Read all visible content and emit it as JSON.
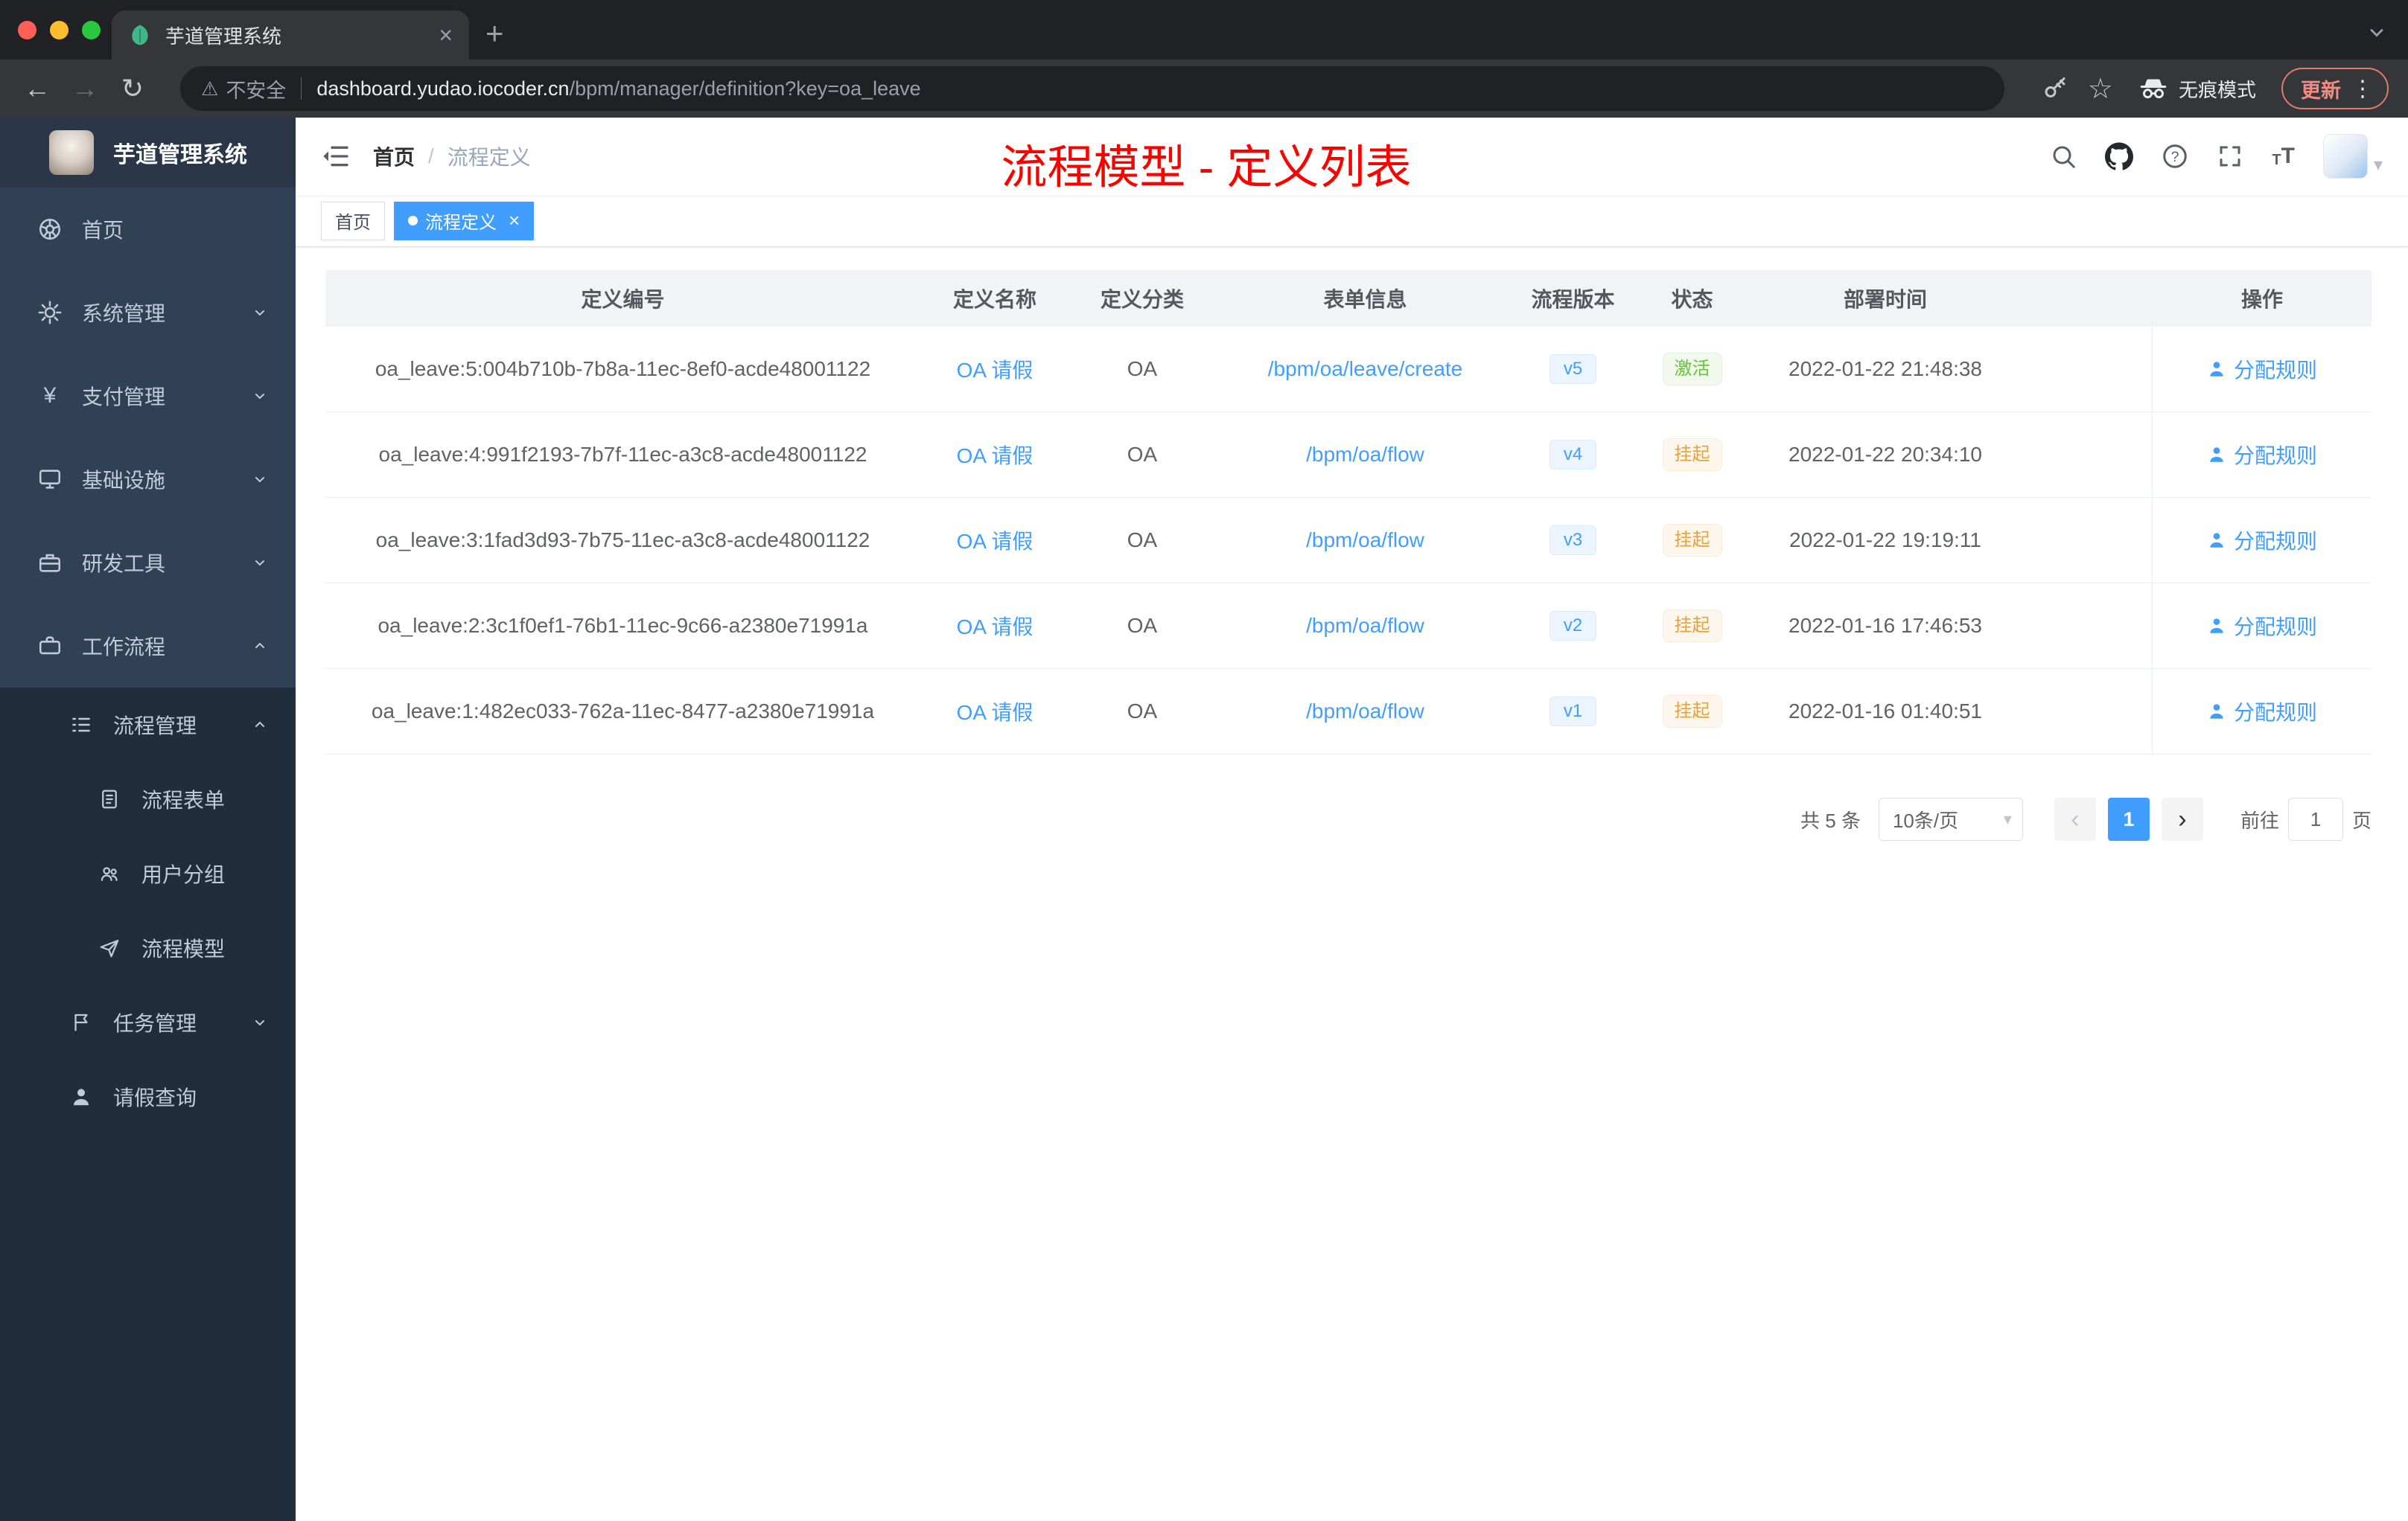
{
  "browser": {
    "tab_title": "芋道管理系统",
    "security_label": "不安全",
    "url_host": "dashboard.yudao.iocoder.cn",
    "url_path": "/bpm/manager/definition?key=oa_leave",
    "incognito_label": "无痕模式",
    "update_label": "更新"
  },
  "sidebar": {
    "app_title": "芋道管理系统",
    "items": [
      {
        "label": "首页"
      },
      {
        "label": "系统管理"
      },
      {
        "label": "支付管理"
      },
      {
        "label": "基础设施"
      },
      {
        "label": "研发工具"
      },
      {
        "label": "工作流程"
      },
      {
        "label": "流程管理"
      },
      {
        "label": "流程表单"
      },
      {
        "label": "用户分组"
      },
      {
        "label": "流程模型"
      },
      {
        "label": "任务管理"
      },
      {
        "label": "请假查询"
      }
    ]
  },
  "navbar": {
    "breadcrumb_home": "首页",
    "breadcrumb_separator": "/",
    "breadcrumb_current": "流程定义",
    "annotation": "流程模型 - 定义列表"
  },
  "tags_view": {
    "tag_home": "首页",
    "tag_active": "流程定义"
  },
  "table": {
    "columns": [
      "定义编号",
      "定义名称",
      "定义分类",
      "表单信息",
      "流程版本",
      "状态",
      "部署时间",
      "操作"
    ],
    "rows": [
      {
        "id": "oa_leave:5:004b710b-7b8a-11ec-8ef0-acde48001122",
        "name": "OA 请假",
        "category": "OA",
        "form": "/bpm/oa/leave/create",
        "version": "v5",
        "status": "激活",
        "time": "2022-01-22 21:48:38",
        "action": "分配规则"
      },
      {
        "id": "oa_leave:4:991f2193-7b7f-11ec-a3c8-acde48001122",
        "name": "OA 请假",
        "category": "OA",
        "form": "/bpm/oa/flow",
        "version": "v4",
        "status": "挂起",
        "time": "2022-01-22 20:34:10",
        "action": "分配规则"
      },
      {
        "id": "oa_leave:3:1fad3d93-7b75-11ec-a3c8-acde48001122",
        "name": "OA 请假",
        "category": "OA",
        "form": "/bpm/oa/flow",
        "version": "v3",
        "status": "挂起",
        "time": "2022-01-22 19:19:11",
        "action": "分配规则"
      },
      {
        "id": "oa_leave:2:3c1f0ef1-76b1-11ec-9c66-a2380e71991a",
        "name": "OA 请假",
        "category": "OA",
        "form": "/bpm/oa/flow",
        "version": "v2",
        "status": "挂起",
        "time": "2022-01-16 17:46:53",
        "action": "分配规则"
      },
      {
        "id": "oa_leave:1:482ec033-762a-11ec-8477-a2380e71991a",
        "name": "OA 请假",
        "category": "OA",
        "form": "/bpm/oa/flow",
        "version": "v1",
        "status": "挂起",
        "time": "2022-01-16 01:40:51",
        "action": "分配规则"
      }
    ]
  },
  "pagination": {
    "total": "共 5 条",
    "page_size": "10条/页",
    "current_page": "1",
    "goto_label": "前往",
    "goto_value": "1",
    "page_unit": "页"
  },
  "colors": {
    "accent": "#409eff",
    "success": "#67c23a",
    "warning": "#e6a23c",
    "annotation_red": "#f80400",
    "sidebar_bg": "#304156",
    "submenu_bg": "#1f2d3d"
  }
}
